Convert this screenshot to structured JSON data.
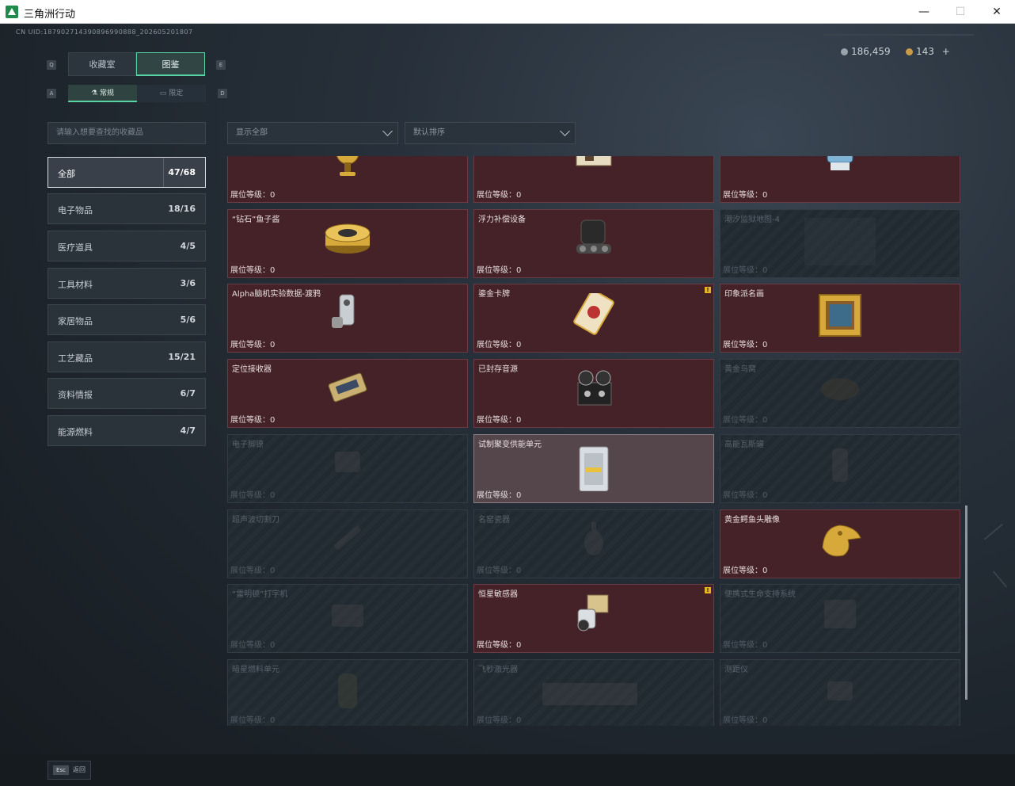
{
  "window": {
    "title": "三角洲行动",
    "minimize": "—",
    "maximize": "☐",
    "close": "✕"
  },
  "uid": "CN UID:187902714390896990888_202605201807",
  "currency": {
    "coins": "186,459",
    "tokens": "143",
    "add": "+"
  },
  "tabs": [
    {
      "label": "收藏室",
      "active": false
    },
    {
      "label": "图鉴",
      "active": true
    }
  ],
  "tab_hints": {
    "left": "Q",
    "right": "E"
  },
  "subtabs": [
    {
      "label": "常规",
      "icon": "flask-icon",
      "active": true
    },
    {
      "label": "限定",
      "icon": "box-icon",
      "active": false
    }
  ],
  "subtab_hints": {
    "left": "A",
    "right": "D"
  },
  "search": {
    "placeholder": "请输入想要查找的收藏品"
  },
  "filters": {
    "show": "显示全部",
    "sort": "默认排序"
  },
  "categories": [
    {
      "label": "全部",
      "count": "47/68",
      "active": true
    },
    {
      "label": "电子物品",
      "count": "18/16"
    },
    {
      "label": "医疗道具",
      "count": "4/5"
    },
    {
      "label": "工具材料",
      "count": "3/6"
    },
    {
      "label": "家居物品",
      "count": "5/6"
    },
    {
      "label": "工艺藏品",
      "count": "15/21"
    },
    {
      "label": "资料情报",
      "count": "6/7"
    },
    {
      "label": "能源燃料",
      "count": "4/7"
    }
  ],
  "level_label": "展位等级：0",
  "items": [
    {
      "name": "",
      "state": "owned",
      "icon": "golden-globe-icon"
    },
    {
      "name": "",
      "state": "owned",
      "icon": "chess-box-icon"
    },
    {
      "name": "",
      "state": "owned",
      "icon": "robot-toy-icon"
    },
    {
      "name": "“钻石”鱼子酱",
      "state": "owned",
      "icon": "caviar-tin-icon"
    },
    {
      "name": "浮力补偿设备",
      "state": "owned",
      "icon": "buoyancy-device-icon"
    },
    {
      "name": "潮汐监狱地图-4",
      "state": "locked",
      "icon": "map-icon"
    },
    {
      "name": "Alpha脑机实验数据-渡鸦",
      "state": "owned",
      "icon": "data-drive-icon"
    },
    {
      "name": "鎏金卡牌",
      "state": "owned",
      "icon": "gold-card-icon",
      "new": true
    },
    {
      "name": "印象派名画",
      "state": "owned",
      "icon": "painting-icon"
    },
    {
      "name": "定位接收器",
      "state": "owned",
      "icon": "receiver-icon"
    },
    {
      "name": "已封存音源",
      "state": "owned",
      "icon": "tape-recorder-icon"
    },
    {
      "name": "黄金鸟窝",
      "state": "locked",
      "icon": "nest-icon"
    },
    {
      "name": "电子脚镣",
      "state": "locked",
      "icon": "shackle-icon"
    },
    {
      "name": "试制聚变供能单元",
      "state": "selected",
      "icon": "fusion-cell-icon"
    },
    {
      "name": "高能瓦斯罐",
      "state": "locked",
      "icon": "gas-tank-icon"
    },
    {
      "name": "超声波切割刀",
      "state": "locked",
      "icon": "cutter-icon"
    },
    {
      "name": "名窑瓷器",
      "state": "locked",
      "icon": "vase-icon"
    },
    {
      "name": "黄金鳄鱼头雕像",
      "state": "owned",
      "icon": "croc-statue-icon"
    },
    {
      "name": "“雷明顿”打字机",
      "state": "locked",
      "icon": "typewriter-icon"
    },
    {
      "name": "恒星敏感器",
      "state": "owned",
      "icon": "star-sensor-icon",
      "new": true
    },
    {
      "name": "便携式生命支持系统",
      "state": "locked",
      "icon": "life-support-icon"
    },
    {
      "name": "暗星燃料单元",
      "state": "locked",
      "icon": "fuel-cell-icon"
    },
    {
      "name": "飞秒激光器",
      "state": "locked",
      "icon": "laser-icon"
    },
    {
      "name": "测距仪",
      "state": "locked",
      "icon": "rangefinder-icon"
    }
  ],
  "footer": {
    "key": "Esc",
    "label": "返回"
  }
}
